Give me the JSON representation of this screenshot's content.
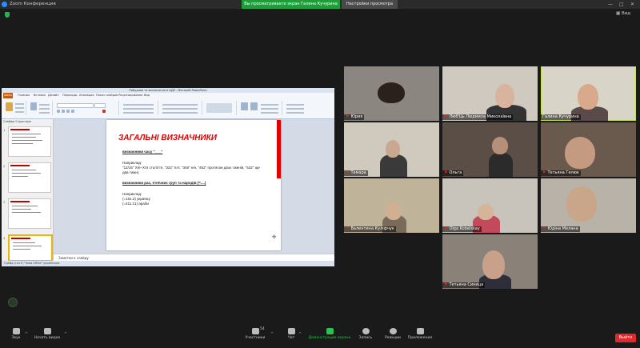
{
  "window": {
    "title": "Zoom Конференция",
    "share_banner": "Вы просматриваете экран Галина Кучурина",
    "view_options": "Настройки просмотра",
    "controls": [
      "—",
      "□",
      "✕"
    ],
    "view_button": "Вид"
  },
  "ppt": {
    "title": "Побудова та визначення в ЦДЕ - Microsoft PowerPoint",
    "file_tab": "Файл",
    "tabs": [
      "Главная",
      "Вставка",
      "Дизайн",
      "Переходы",
      "Анимация",
      "Показ слайдов",
      "Рецензирование",
      "Вид"
    ],
    "thumb_tabs": "Слайды   Структура",
    "slide_numbers": [
      "1",
      "2",
      "3",
      "4"
    ],
    "slide": {
      "title": "ЗАГАЛЬНІ ВИЗНАЧНИКИ",
      "time_heading": "визначники часу \"___\"",
      "example1_label": "Наприклад:",
      "example1_line1": "\"12/15\" XIII–XVI століття, \"322\" плт, \"348\" н/н, \"452\" протягом двох тижнів, \"532\" ще",
      "example1_line2": "двa тижні;",
      "races_heading": "визначники рас, етнічних груп та народів (=....)",
      "example2_label": "Наприклад:",
      "example2_line1": "(=161.2) українці",
      "example2_line2": "(=411.21) араби"
    },
    "notes_placeholder": "Заметки к слайду",
    "status": "Слайд 4 из 8    \"Тема Office\"    українська"
  },
  "participants": [
    {
      "name": "Юрия",
      "muted": true
    },
    {
      "name": "Люб'Ць Людмила Миколаївна",
      "muted": true
    },
    {
      "name": "Галина Кучурина",
      "muted": false,
      "active": true
    },
    {
      "name": "Тамара",
      "muted": true
    },
    {
      "name": "Ольга",
      "muted": true
    },
    {
      "name": "Тетьяна Гелюк",
      "muted": true
    },
    {
      "name": "Валентина Куліфчук",
      "muted": true
    },
    {
      "name": "Olga Kobelskay",
      "muted": true
    },
    {
      "name": "Юдіна Мелана",
      "muted": true
    },
    {
      "name": "Тетьяна Синица",
      "muted": true
    }
  ],
  "toolbar": {
    "audio": "Звук",
    "video": "Начать видео",
    "participants": "Участники",
    "participants_count": "54",
    "chat": "Чат",
    "share": "Демонстрация экрана",
    "record": "Запись",
    "reactions": "Реакции",
    "apps": "Приложения",
    "leave": "Выйти"
  }
}
